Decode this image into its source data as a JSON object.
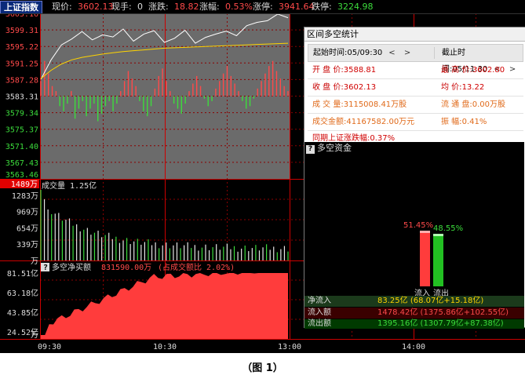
{
  "header": {
    "index_name": "上证指数",
    "price_label": "现价:",
    "price": "3602.13",
    "hand_label": "现手:",
    "hand": "0",
    "change_label": "涨跌:",
    "change": "18.82",
    "pct_label": "涨幅:",
    "pct": "0.53%",
    "limit_up_label": "涨停:",
    "limit_up": "3941.64",
    "limit_down_label": "跌停:",
    "limit_down": "3224.98"
  },
  "price_axis": [
    "3603.16",
    "3599.31",
    "3595.22",
    "3591.25",
    "3587.28",
    "3583.31",
    "3579.34",
    "3575.37",
    "3571.40",
    "3567.43",
    "3563.46"
  ],
  "volume_pane": {
    "label": "成交量",
    "value": "1.25亿",
    "cursor_tag": "1489万",
    "axis": [
      "1283万",
      "969万",
      "654万",
      "339万",
      "万"
    ]
  },
  "netflow_pane": {
    "label": "多空净买额",
    "value": "831590.00万",
    "ratio": "(占成交额比 2.02%)",
    "axis": [
      "81.51亿",
      "63.18亿",
      "43.85亿",
      "24.52亿",
      "万"
    ]
  },
  "time_axis": [
    "09:30",
    "10:30",
    "13:00",
    "14:00"
  ],
  "colors": {
    "up": "#ff4a4a",
    "down": "#3cdc3c",
    "avg_line": "#ffd400",
    "price_line": "#ffffff",
    "grid": "#8b0000"
  },
  "chart_data": {
    "type": "line",
    "x": [
      "09:30",
      "09:35",
      "09:40",
      "09:45",
      "09:50",
      "09:55",
      "10:00",
      "10:05",
      "10:10",
      "10:15",
      "10:20",
      "10:25",
      "10:30",
      "10:35",
      "10:40",
      "10:45",
      "10:50",
      "10:55",
      "11:00",
      "11:05",
      "11:10",
      "11:15",
      "11:20",
      "11:25",
      "11:30"
    ],
    "series": [
      {
        "name": "现价",
        "values": [
          3587.3,
          3592.0,
          3595.6,
          3597.0,
          3598.8,
          3596.8,
          3598.0,
          3597.5,
          3599.4,
          3596.5,
          3598.2,
          3599.0,
          3596.2,
          3597.2,
          3599.1,
          3596.0,
          3597.4,
          3598.2,
          3598.9,
          3597.8,
          3600.2,
          3601.0,
          3601.4,
          3603.0,
          3602.1
        ]
      },
      {
        "name": "均价",
        "values": [
          3587.5,
          3589.5,
          3591.0,
          3592.0,
          3592.6,
          3593.0,
          3593.4,
          3593.7,
          3594.0,
          3594.2,
          3594.4,
          3594.6,
          3594.8,
          3594.9,
          3595.0,
          3595.1,
          3595.2,
          3595.3,
          3595.4,
          3595.5,
          3595.6,
          3595.7,
          3595.8,
          3595.9,
          3596.0
        ]
      }
    ],
    "ylim": [
      3563.46,
      3603.16
    ]
  },
  "panel": {
    "title": "区间多空统计",
    "start_label": "起始时间:",
    "start_time": "05/09:30",
    "start_nav": "< >",
    "end_label": "截止时间:",
    "end_time": "05/11:30",
    "end_nav": "< >",
    "open_label": "开 盘 价:",
    "open": "3588.81",
    "high_label": "最 高 价:",
    "high": "3602.80",
    "close_label": "收 盘 价:",
    "close": "3602.13",
    "avg_label": "均    价:",
    "avg": "13.22",
    "vol_label": "成 交 量:",
    "vol": "3115008.41万股",
    "turnover_label": "流 通 盘:",
    "turnover": "0.00万股",
    "amount_label": "成交金额:",
    "amount": "41167582.00万元",
    "amp_label": "振    幅:",
    "amp": "0.41%",
    "range_label": "同期上证涨跌幅:",
    "range_pct": "0.37%"
  },
  "money_flow": {
    "title": "多空资金",
    "in_pct": "51.45%",
    "out_pct": "48.55%",
    "in_label": "流入",
    "out_label": "流出",
    "in_share": 0.5145,
    "out_share": 0.4855,
    "net_in_label": "净流入",
    "net_in": "83.25亿",
    "net_in_detail": "(68.07亿+15.18亿)",
    "in_amt_label": "流入额",
    "in_amt": "1478.42亿",
    "in_amt_detail": "(1375.86亿+102.55亿)",
    "out_amt_label": "流出额",
    "out_amt": "1395.16亿",
    "out_amt_detail": "(1307.79亿+87.38亿)"
  },
  "caption": "（图 1）"
}
